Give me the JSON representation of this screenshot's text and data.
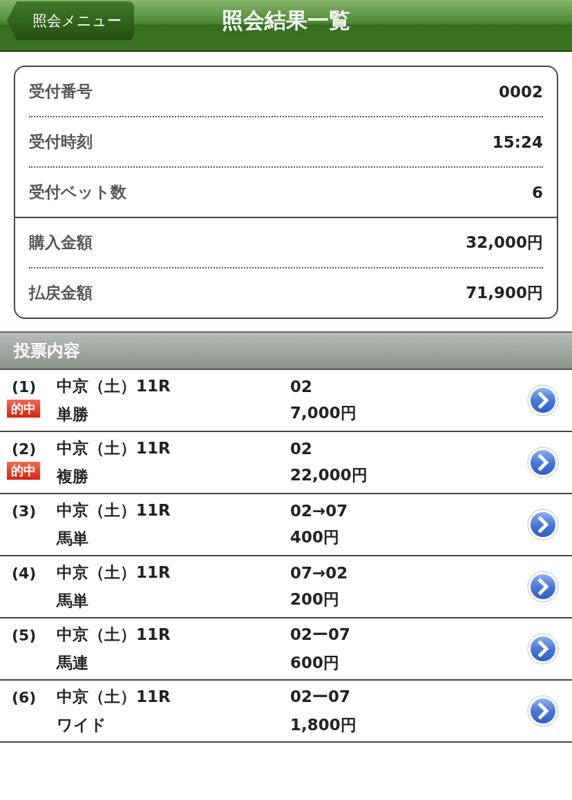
{
  "nav": {
    "back_label": "照会メニュー",
    "title": "照会結果一覧"
  },
  "summary": {
    "groups": [
      [
        {
          "label": "受付番号",
          "value": "0002"
        },
        {
          "label": "受付時刻",
          "value": "15:24"
        },
        {
          "label": "受付ベット数",
          "value": "6"
        }
      ],
      [
        {
          "label": "購入金額",
          "value": "32,000円"
        },
        {
          "label": "払戻金額",
          "value": "71,900円"
        }
      ]
    ]
  },
  "section": {
    "title": "投票内容"
  },
  "bets": [
    {
      "number": "(1)",
      "race": "中京（土）11R",
      "type": "単勝",
      "selection": "02",
      "amount": "7,000円",
      "hit": true,
      "hit_label": "的中"
    },
    {
      "number": "(2)",
      "race": "中京（土）11R",
      "type": "複勝",
      "selection": "02",
      "amount": "22,000円",
      "hit": true,
      "hit_label": "的中"
    },
    {
      "number": "(3)",
      "race": "中京（土）11R",
      "type": "馬単",
      "selection": "02→07",
      "amount": "400円",
      "hit": false
    },
    {
      "number": "(4)",
      "race": "中京（土）11R",
      "type": "馬単",
      "selection": "07→02",
      "amount": "200円",
      "hit": false
    },
    {
      "number": "(5)",
      "race": "中京（土）11R",
      "type": "馬連",
      "selection": "02ー07",
      "amount": "600円",
      "hit": false
    },
    {
      "number": "(6)",
      "race": "中京（土）11R",
      "type": "ワイド",
      "selection": "02ー07",
      "amount": "1,800円",
      "hit": false
    }
  ]
}
